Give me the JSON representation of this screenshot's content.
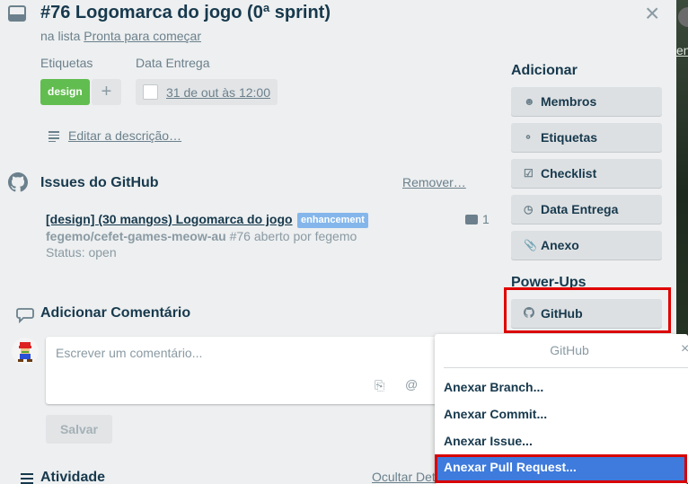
{
  "card": {
    "title": "#76 Logomarca do jogo (0ª sprint)",
    "in_list_prefix": "na lista",
    "list_name": "Pronta para começar",
    "close_symbol": "×",
    "labels_heading": "Etiquetas",
    "label_design": "design",
    "add_label_symbol": "+",
    "due_heading": "Data Entrega",
    "due_date": "31 de out às 12:00",
    "edit_description": "Editar a descrição…"
  },
  "github_issues": {
    "heading": "Issues do GitHub",
    "remove": "Remover…",
    "issue_title": "[design] (30 mangos) Logomarca do jogo",
    "issue_label": "enhancement",
    "repo": "fegemo/cefet-games-meow-au",
    "issue_desc": "#76 aberto por fegemo",
    "status": "Status: open",
    "comment_count": "1"
  },
  "comment": {
    "heading": "Adicionar Comentário",
    "placeholder": "Escrever um comentário...",
    "attach_icon": "⎘",
    "mention_icon": "@",
    "save": "Salvar"
  },
  "activity": {
    "heading": "Atividade",
    "hide_details": "Ocultar Detalhes"
  },
  "sidebar": {
    "add_heading": "Adicionar",
    "buttons": [
      {
        "label": "Membros",
        "icon": "member-icon"
      },
      {
        "label": "Etiquetas",
        "icon": "label-icon"
      },
      {
        "label": "Checklist",
        "icon": "checklist-icon"
      },
      {
        "label": "Data Entrega",
        "icon": "clock-icon"
      },
      {
        "label": "Anexo",
        "icon": "attachment-icon"
      }
    ],
    "powerups_heading": "Power-Ups",
    "github_button": "GitHub"
  },
  "github_popover": {
    "title": "GitHub",
    "close_symbol": "×",
    "items": [
      "Anexar Branch...",
      "Anexar Commit...",
      "Anexar Issue...",
      "Anexar Pull Request..."
    ]
  },
  "background": {
    "peek_text": "en"
  },
  "colors": {
    "label_green": "#61bd4f",
    "enhancement_blue": "#84b6eb",
    "highlight_red": "#e00000",
    "active_item_blue": "#3e7bdc"
  }
}
